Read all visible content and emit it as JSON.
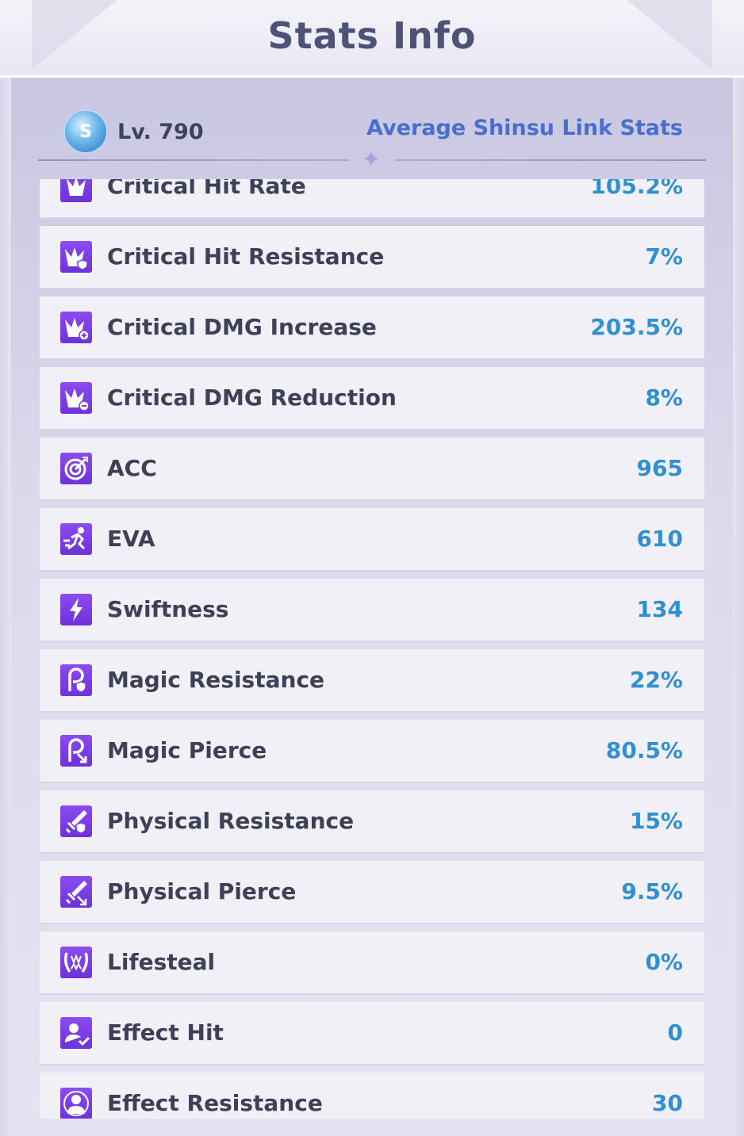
{
  "header": {
    "title": "Stats Info"
  },
  "level": {
    "label": "Lv. 790",
    "badge_icon": "shinsu-badge-icon",
    "badge_glyph": "S"
  },
  "average_link": "Average Shinsu Link Stats",
  "colors": {
    "title": "#4f5278",
    "value": "#2f8fd0",
    "link": "#4a6ecf",
    "icon_bg": "#7b3fe4"
  },
  "stats": [
    {
      "label": "Critical Hit Rate",
      "value": "105.2%",
      "icon": "critical-hit-rate-icon"
    },
    {
      "label": "Critical Hit Resistance",
      "value": "7%",
      "icon": "critical-hit-resistance-icon"
    },
    {
      "label": "Critical DMG Increase",
      "value": "203.5%",
      "icon": "critical-dmg-increase-icon"
    },
    {
      "label": "Critical DMG Reduction",
      "value": "8%",
      "icon": "critical-dmg-reduction-icon"
    },
    {
      "label": "ACC",
      "value": "965",
      "icon": "target-icon"
    },
    {
      "label": "EVA",
      "value": "610",
      "icon": "running-icon"
    },
    {
      "label": "Swiftness",
      "value": "134",
      "icon": "lightning-icon"
    },
    {
      "label": "Magic Resistance",
      "value": "22%",
      "icon": "magic-resistance-icon"
    },
    {
      "label": "Magic Pierce",
      "value": "80.5%",
      "icon": "magic-pierce-icon"
    },
    {
      "label": "Physical Resistance",
      "value": "15%",
      "icon": "physical-resistance-icon"
    },
    {
      "label": "Physical Pierce",
      "value": "9.5%",
      "icon": "physical-pierce-icon"
    },
    {
      "label": "Lifesteal",
      "value": "0%",
      "icon": "fangs-icon"
    },
    {
      "label": "Effect Hit",
      "value": "0",
      "icon": "effect-hit-icon"
    },
    {
      "label": "Effect Resistance",
      "value": "30",
      "icon": "effect-resistance-icon"
    }
  ]
}
